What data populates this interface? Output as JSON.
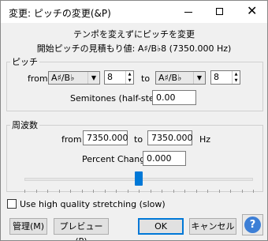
{
  "window": {
    "title": "変更: ピッチの変更(&P)",
    "minimize_glyph": "—",
    "maximize_glyph": "□",
    "close_glyph": "✕"
  },
  "header": {
    "description": "テンポを変えずにピッチを変更",
    "estimate": "開始ピッチの見積もり値: A♯/B♭8 (7350.000 Hz)"
  },
  "pitch": {
    "group_label": "ピッチ",
    "from_label": "from",
    "from_note": "A♯/B♭",
    "from_octave": "8",
    "to_label": "to",
    "to_note": "A♯/B♭",
    "to_octave": "8",
    "semitones_label": "Semitones (half-steps):",
    "semitones_value": "0.00"
  },
  "frequency": {
    "group_label": "周波数",
    "from_label": "from",
    "from_value": "7350.000",
    "to_label": "to",
    "to_value": "7350.000",
    "unit": "Hz",
    "percent_label": "Percent Change:",
    "percent_value": "0.000",
    "slider_percent": 50
  },
  "options": {
    "high_quality_label": "Use high quality stretching (slow)",
    "high_quality_checked": false
  },
  "buttons": {
    "manage": "管理(M)",
    "preview": "プレビュー(P)",
    "ok": "OK",
    "cancel": "キャンセル",
    "help": "?"
  },
  "colors": {
    "accent": "#0078d7",
    "help_button": "#3d7fd6"
  }
}
